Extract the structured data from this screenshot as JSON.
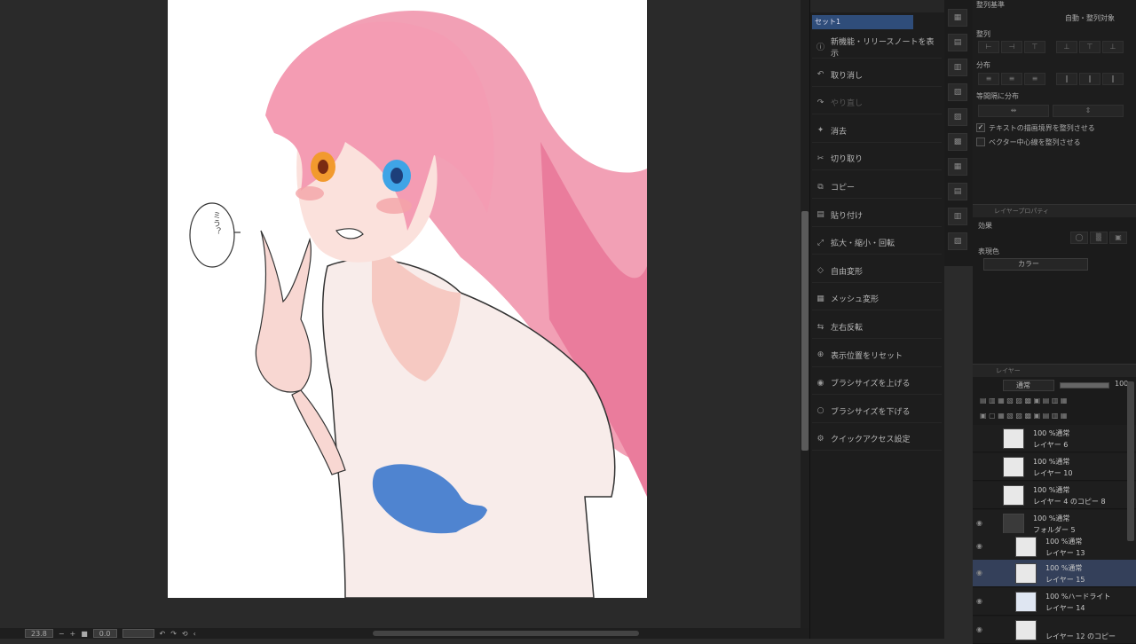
{
  "status_bar": {
    "zoom": "23.8",
    "rotation": "0.0"
  },
  "quick_access": {
    "header": "",
    "set_label": "セット1",
    "items": [
      {
        "icon": "info-icon",
        "label": "新機能・リリースノートを表示"
      },
      {
        "icon": "undo-icon",
        "label": "取り消し"
      },
      {
        "icon": "redo-icon",
        "label": "やり直し"
      },
      {
        "icon": "erase-icon",
        "label": "消去"
      },
      {
        "icon": "cut-icon",
        "label": "切り取り"
      },
      {
        "icon": "copy-icon",
        "label": "コピー"
      },
      {
        "icon": "paste-icon",
        "label": "貼り付け"
      },
      {
        "icon": "transform-icon",
        "label": "拡大・縮小・回転"
      },
      {
        "icon": "free-transform-icon",
        "label": "自由変形"
      },
      {
        "icon": "mesh-icon",
        "label": "メッシュ変形"
      },
      {
        "icon": "flip-icon",
        "label": "左右反転"
      },
      {
        "icon": "reset-view-icon",
        "label": "表示位置をリセット"
      },
      {
        "icon": "brush-up-icon",
        "label": "ブラシサイズを上げる"
      },
      {
        "icon": "brush-down-icon",
        "label": "ブラシサイズを下げる"
      },
      {
        "icon": "settings-icon",
        "label": "クイックアクセス設定"
      }
    ]
  },
  "align_panel": {
    "basis_label": "整列基準",
    "basis_value": "自動・整列対象",
    "align_label": "整列",
    "distribute_label": "分布",
    "equal_label": "等間隔に分布",
    "check1": "テキストの描画境界を整列させる",
    "check2": "ベクター中心線を整列させる"
  },
  "prop_panel": {
    "title": "レイヤープロパティ",
    "effect_label": "効果",
    "color_label": "表現色",
    "color_value": "カラー"
  },
  "layer_panel": {
    "title": "レイヤー",
    "blend": "通常",
    "opacity": "100",
    "layers": [
      {
        "mode": "100 %通常",
        "name": "レイヤー 6"
      },
      {
        "mode": "100 %通常",
        "name": "レイヤー 10"
      },
      {
        "mode": "100 %通常",
        "name": "レイヤー 4 のコピー 8"
      },
      {
        "mode": "100 %通常",
        "name": "フォルダー 5"
      },
      {
        "mode": "100 %通常",
        "name": "レイヤー 13"
      },
      {
        "mode": "100 %通常",
        "name": "レイヤー 15"
      },
      {
        "mode": "100 %ハードライト",
        "name": "レイヤー 14"
      },
      {
        "mode": "",
        "name": "レイヤー 12 のコピー"
      }
    ]
  },
  "artwork": {
    "speech_text": "ミう？"
  }
}
